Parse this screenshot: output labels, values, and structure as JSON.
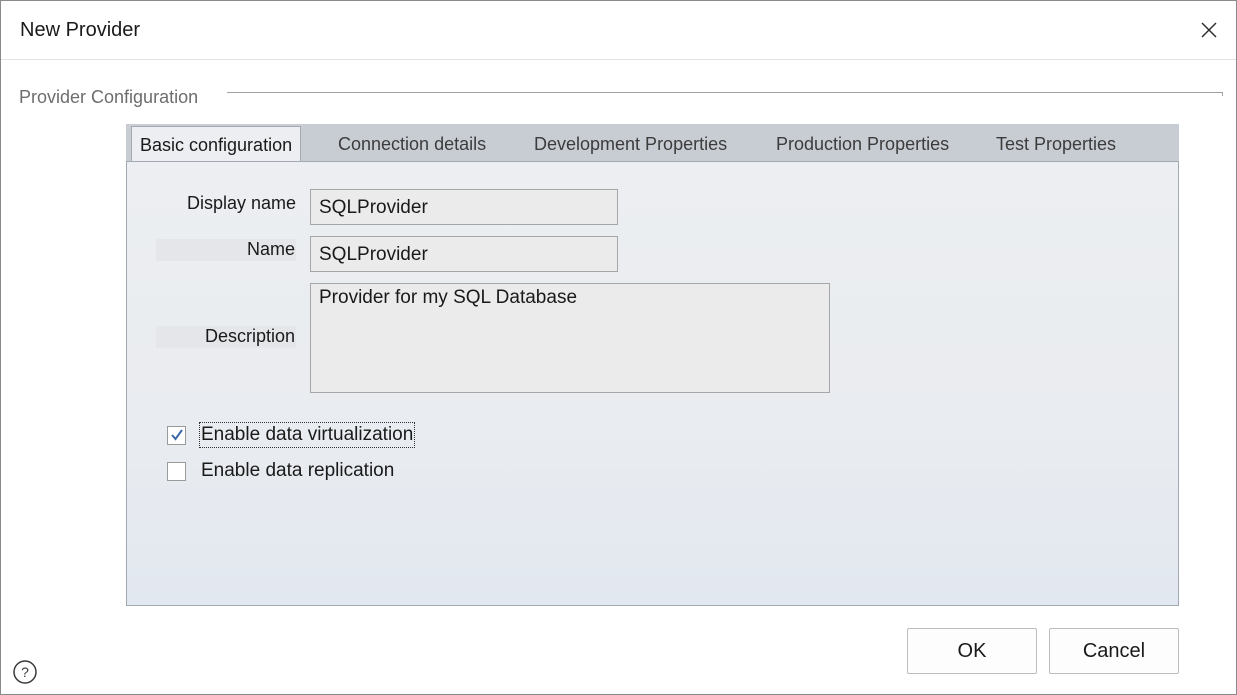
{
  "window": {
    "title": "New Provider",
    "close_icon": "close-icon"
  },
  "group": {
    "label": "Provider Configuration"
  },
  "tabs": [
    {
      "label": "Basic configuration",
      "active": true
    },
    {
      "label": "Connection details",
      "active": false
    },
    {
      "label": "Development Properties",
      "active": false
    },
    {
      "label": "Production Properties",
      "active": false
    },
    {
      "label": "Test Properties",
      "active": false
    }
  ],
  "form": {
    "display_name": {
      "label": "Display name",
      "value": "SQLProvider"
    },
    "name": {
      "label": "Name",
      "value": "SQLProvider"
    },
    "description": {
      "label": "Description",
      "value": "Provider for my SQL Database"
    },
    "virtualization": {
      "label": "Enable data virtualization",
      "checked": true
    },
    "replication": {
      "label": "Enable data replication",
      "checked": false
    }
  },
  "buttons": {
    "ok": "OK",
    "cancel": "Cancel",
    "help_icon": "help-icon"
  },
  "colors": {
    "tabstrip": "#c8cdd4",
    "panel": "#eceef1",
    "field": "#ebebeb",
    "check_accent": "#3c6aa8"
  }
}
